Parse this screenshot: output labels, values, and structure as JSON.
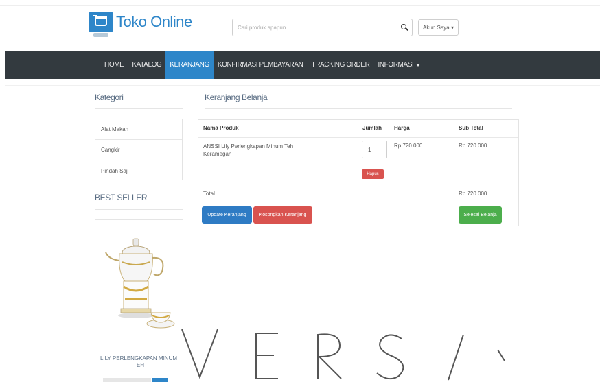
{
  "header": {
    "logo_text": "Toko Online",
    "search_placeholder": "Cari produk apapun",
    "account_label": "Akun Saya ▾"
  },
  "navbar": {
    "items": [
      {
        "label": "HOME",
        "active": false
      },
      {
        "label": "KATALOG",
        "active": false
      },
      {
        "label": "KERANJANG",
        "active": true
      },
      {
        "label": "KONFIRMASI PEMBAYARAN",
        "active": false
      },
      {
        "label": "TRACKING ORDER",
        "active": false
      },
      {
        "label": "INFORMASI",
        "active": false
      }
    ]
  },
  "sidebar": {
    "category_title": "Kategori",
    "categories": [
      "Alat Makan",
      "Cangkir",
      "Pindah Saji"
    ],
    "best_seller_title": "BEST SELLER",
    "product_name": "LILY PERLENGKAPAN MINUM TEH"
  },
  "main": {
    "title": "Keranjang Belanja",
    "columns": {
      "product": "Nama Produk",
      "qty": "Jumlah",
      "price": "Harga",
      "subtotal": "Sub Total"
    },
    "items": [
      {
        "name": "ANSSI Lily Perlengkapan Minum Teh Keramegan",
        "qty": "1",
        "price": "Rp 720.000",
        "subtotal": "Rp 720.000",
        "delete_label": "Hapus"
      }
    ],
    "total_label": "Total",
    "total_value": "Rp 720.000",
    "buttons": {
      "update": "Update Keranjang",
      "clear": "Kosongkan Keranjang",
      "checkout": "Selesai Belanja"
    }
  },
  "colors": {
    "navbar_bg": "#333a3f",
    "accent": "#2e86c9",
    "danger": "#d9534f",
    "success": "#4cae4c"
  },
  "icons": {
    "logo": "cart-icon",
    "search": "search-icon"
  }
}
